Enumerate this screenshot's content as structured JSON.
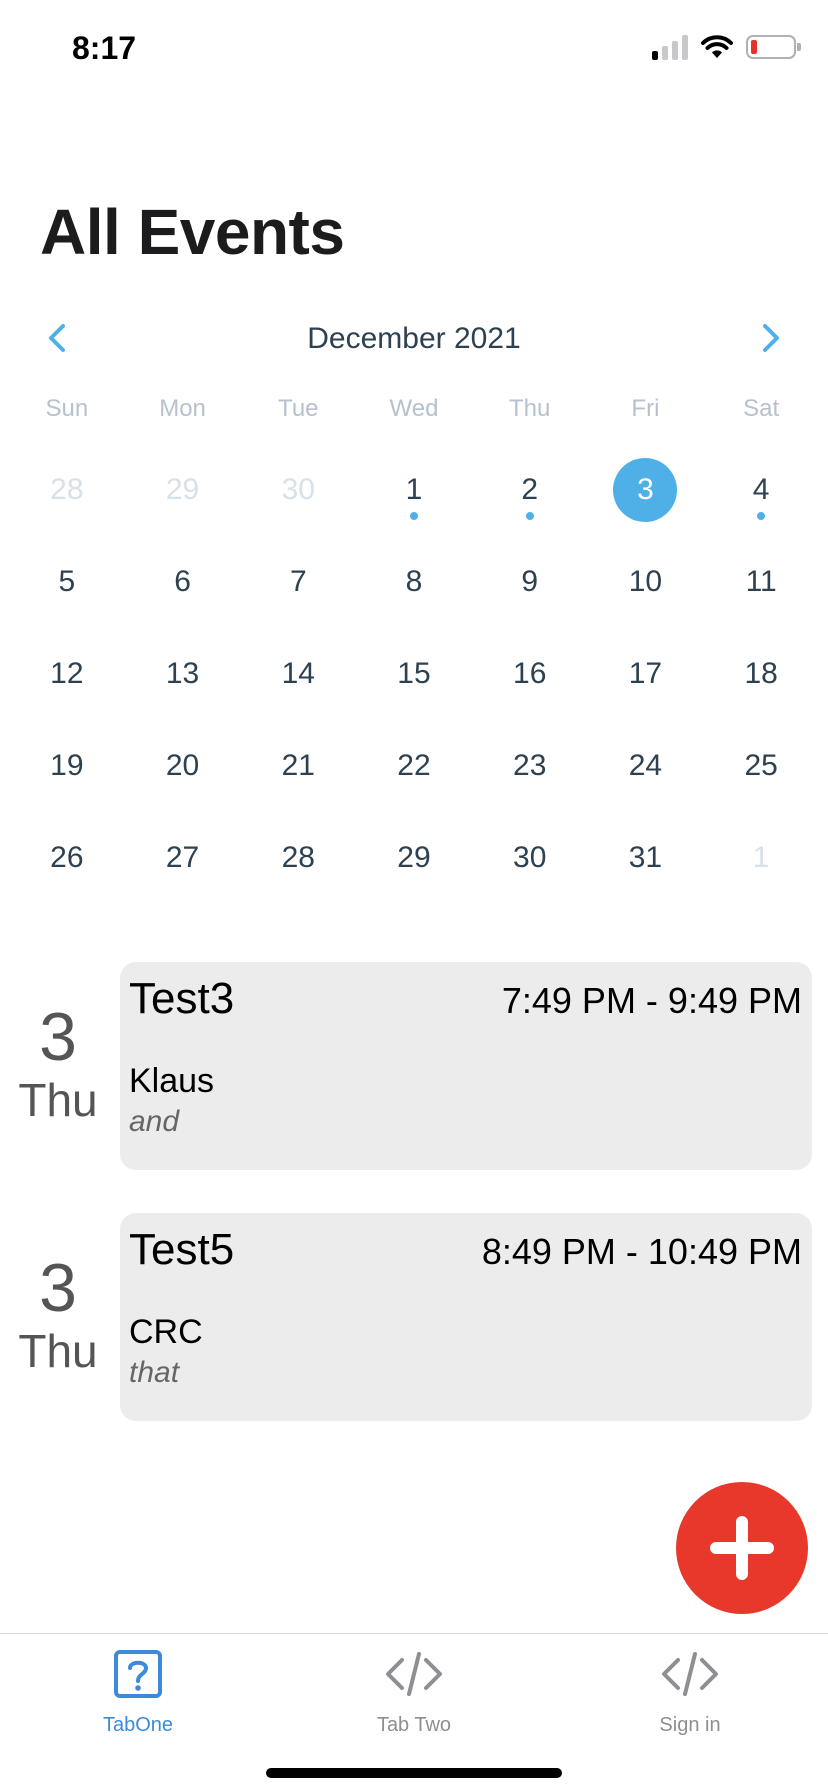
{
  "status_bar": {
    "time": "8:17",
    "signal_bars_on": 1,
    "battery_level": 0.1
  },
  "title": "All Events",
  "calendar": {
    "month_label": "December 2021",
    "weekdays": [
      "Sun",
      "Mon",
      "Tue",
      "Wed",
      "Thu",
      "Fri",
      "Sat"
    ],
    "selected_day": "3",
    "weeks": [
      [
        {
          "d": "28",
          "muted": true
        },
        {
          "d": "29",
          "muted": true
        },
        {
          "d": "30",
          "muted": true
        },
        {
          "d": "1",
          "dot": true
        },
        {
          "d": "2",
          "dot": true
        },
        {
          "d": "3",
          "selected": true,
          "dot": true
        },
        {
          "d": "4",
          "dot": true
        }
      ],
      [
        {
          "d": "5"
        },
        {
          "d": "6"
        },
        {
          "d": "7"
        },
        {
          "d": "8"
        },
        {
          "d": "9"
        },
        {
          "d": "10"
        },
        {
          "d": "11"
        }
      ],
      [
        {
          "d": "12"
        },
        {
          "d": "13"
        },
        {
          "d": "14"
        },
        {
          "d": "15"
        },
        {
          "d": "16"
        },
        {
          "d": "17"
        },
        {
          "d": "18"
        }
      ],
      [
        {
          "d": "19"
        },
        {
          "d": "20"
        },
        {
          "d": "21"
        },
        {
          "d": "22"
        },
        {
          "d": "23"
        },
        {
          "d": "24"
        },
        {
          "d": "25"
        }
      ],
      [
        {
          "d": "26"
        },
        {
          "d": "27"
        },
        {
          "d": "28"
        },
        {
          "d": "29"
        },
        {
          "d": "30"
        },
        {
          "d": "31"
        },
        {
          "d": "1",
          "muted": true
        }
      ]
    ]
  },
  "events": [
    {
      "day": "3",
      "weekday": "Thu",
      "title": "Test3",
      "time": "7:49 PM - 9:49 PM",
      "name": "Klaus",
      "note": "and"
    },
    {
      "day": "3",
      "weekday": "Thu",
      "title": "Test5",
      "time": "8:49 PM - 10:49 PM",
      "name": "CRC",
      "note": "that"
    }
  ],
  "tabs": [
    {
      "label": "TabOne",
      "icon": "help-square-icon",
      "active": true
    },
    {
      "label": "Tab Two",
      "icon": "code-icon",
      "active": false
    },
    {
      "label": "Sign in",
      "icon": "code-icon",
      "active": false
    }
  ],
  "colors": {
    "accent": "#4fb0e8",
    "fab": "#e7382b",
    "tab_active": "#3b8bd8"
  }
}
